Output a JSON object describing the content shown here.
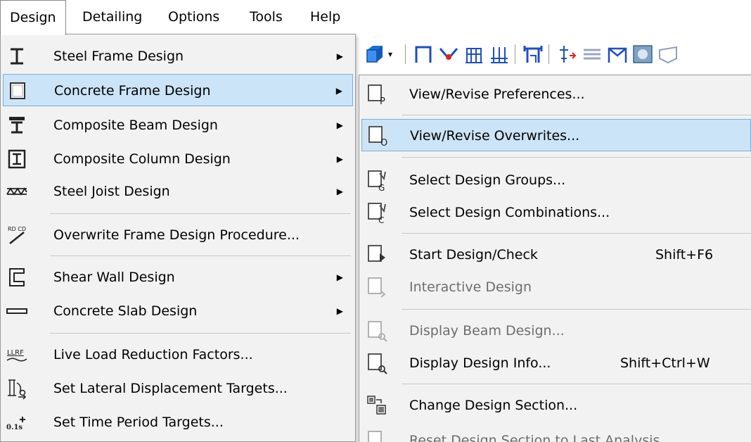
{
  "menubar": {
    "items": [
      {
        "label": "Design",
        "active": true
      },
      {
        "label": "Detailing"
      },
      {
        "label": "Options"
      },
      {
        "label": "Tools"
      },
      {
        "label": "Help"
      }
    ]
  },
  "design_menu": {
    "items": [
      {
        "label": "Steel Frame Design",
        "icon": "steel-frame-icon",
        "submenu": true
      },
      {
        "label": "Concrete Frame Design",
        "icon": "concrete-frame-icon",
        "submenu": true,
        "highlighted": true
      },
      {
        "label": "Composite Beam Design",
        "icon": "composite-beam-icon",
        "submenu": true
      },
      {
        "label": "Composite Column Design",
        "icon": "composite-column-icon",
        "submenu": true
      },
      {
        "label": "Steel Joist Design",
        "icon": "steel-joist-icon",
        "submenu": true
      },
      {
        "label": "Overwrite Frame Design Procedure...",
        "icon": "overwrite-procedure-icon"
      },
      {
        "label": "Shear Wall Design",
        "icon": "shear-wall-icon",
        "submenu": true
      },
      {
        "label": "Concrete Slab Design",
        "icon": "concrete-slab-icon",
        "submenu": true
      },
      {
        "label": "Live Load Reduction Factors...",
        "icon": "llrf-icon"
      },
      {
        "label": "Set Lateral Displacement Targets...",
        "icon": "lateral-displacement-icon"
      },
      {
        "label": "Set Time Period Targets...",
        "icon": "time-period-icon"
      }
    ],
    "arrow_glyph": "▶",
    "llrf_text": "LLRF",
    "time_text": "0.1s",
    "overwrite_text": "RD CD"
  },
  "concrete_submenu": {
    "items": [
      {
        "label": "View/Revise Preferences...",
        "icon": "preferences-icon",
        "badge": "P"
      },
      {
        "label": "View/Revise Overwrites...",
        "icon": "overwrites-icon",
        "badge": "O",
        "highlighted": true
      },
      {
        "label": "Select Design Groups...",
        "icon": "design-groups-icon",
        "badge": "G"
      },
      {
        "label": "Select Design Combinations...",
        "icon": "design-combinations-icon",
        "badge": "C"
      },
      {
        "label": "Start Design/Check",
        "icon": "start-design-icon",
        "shortcut": "Shift+F6"
      },
      {
        "label": "Interactive Design",
        "icon": "interactive-design-icon",
        "disabled": true
      },
      {
        "label": "Display Beam Design...",
        "icon": "display-beam-icon",
        "disabled": true
      },
      {
        "label": "Display Design Info...",
        "icon": "display-info-icon",
        "shortcut": "Shift+Ctrl+W"
      },
      {
        "label": "Change Design Section...",
        "icon": "change-section-icon"
      },
      {
        "label": "Reset Design Section to Last Analysis",
        "icon": "reset-section-icon",
        "disabled": true
      }
    ]
  },
  "colors": {
    "highlight_bg": "#cce4f7",
    "highlight_border": "#7aaed8",
    "menu_bg": "#f2f2f2",
    "disabled_text": "#6d6d6d",
    "toolbar_blue": "#1d6fd6"
  }
}
